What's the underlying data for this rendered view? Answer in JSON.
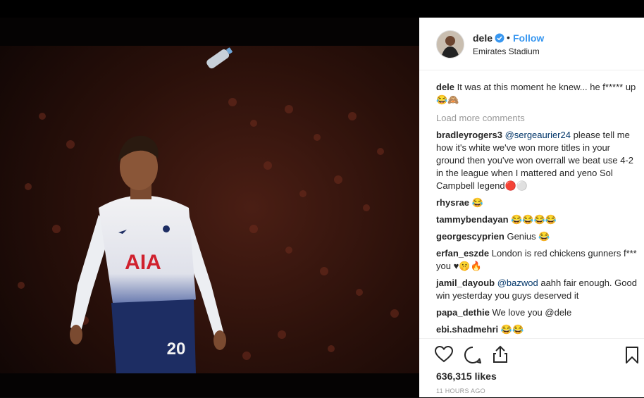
{
  "post": {
    "username": "dele",
    "follow_label": "Follow",
    "location": "Emirates Stadium",
    "caption_user": "dele",
    "caption_text": "It was at this moment he knew... he f***** up 😂🙈",
    "load_more": "Load more comments",
    "likes_count": "636,315",
    "likes_label": "likes",
    "timestamp": "11 HOURS AGO"
  },
  "photo": {
    "shirt_text": "AIA",
    "number": "20"
  },
  "comments": [
    {
      "user": "bradleyrogers3",
      "mention": "@sergeaurier24",
      "text": "please tell me how it's white we've won more titles in your ground then you've won overrall we beat use 4-2 in the league when I mattered and yeno Sol Campbell legend🔴⚪"
    },
    {
      "user": "rhysrae",
      "mention": "",
      "text": "😂"
    },
    {
      "user": "tammybendayan",
      "mention": "",
      "text": "😂😂😂😂"
    },
    {
      "user": "georgescyprien",
      "mention": "",
      "text": "Genius 😂"
    },
    {
      "user": "erfan_eszde",
      "mention": "",
      "text": "London is red chickens gunners f*** you ♥🤫🔥"
    },
    {
      "user": "jamil_dayoub",
      "mention": "@bazwod",
      "text": "aahh fair enough. Good win yesterday you guys deserved it"
    },
    {
      "user": "papa_dethie",
      "mention": "",
      "text": "We love you @dele"
    },
    {
      "user": "ebi.shadmehri",
      "mention": "",
      "text": "😂😂"
    }
  ],
  "colors": {
    "accent": "#3897f0",
    "verified": "#3897f0",
    "mention": "#003569",
    "secondary": "#999999"
  },
  "icons": [
    "verified-badge-icon",
    "heart-icon",
    "comment-icon",
    "share-icon",
    "bookmark-icon"
  ]
}
